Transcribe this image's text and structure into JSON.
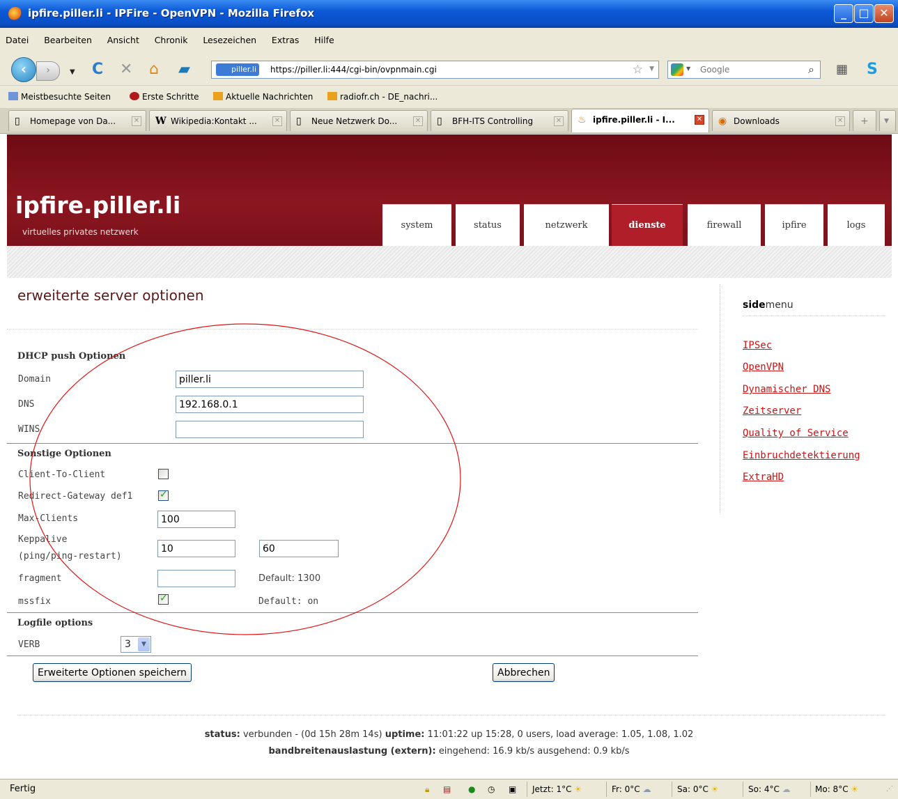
{
  "window": {
    "title": "ipfire.piller.li - IPFire - OpenVPN - Mozilla Firefox"
  },
  "menu": [
    "Datei",
    "Bearbeiten",
    "Ansicht",
    "Chronik",
    "Lesezeichen",
    "Extras",
    "Hilfe"
  ],
  "nav": {
    "site_badge": "piller.li",
    "url": "https://piller.li:444/cgi-bin/ovpnmain.cgi",
    "search_placeholder": "Google"
  },
  "bookmarks": [
    "Meistbesuchte Seiten",
    "Erste Schritte",
    "Aktuelle Nachrichten",
    "radiofr.ch - DE_nachri..."
  ],
  "tabs": [
    {
      "label": "Homepage von Da...",
      "icon": "page-icon"
    },
    {
      "label": "Wikipedia:Kontakt ...",
      "icon": "wikipedia-icon"
    },
    {
      "label": "Neue Netzwerk Do...",
      "icon": "page-icon"
    },
    {
      "label": "BFH-ITS Controlling",
      "icon": "page-icon"
    },
    {
      "label": "ipfire.piller.li - I...",
      "icon": "ipfire-icon",
      "active": true
    },
    {
      "label": "Downloads",
      "icon": "downloads-icon"
    }
  ],
  "site": {
    "brand": "ipfire.piller.li",
    "slogan": "virtuelles privates netzwerk",
    "nav": [
      "system",
      "status",
      "netzwerk",
      "dienste",
      "firewall",
      "ipfire",
      "logs"
    ],
    "active_nav": "dienste",
    "accent": "#b01e2a"
  },
  "page": {
    "title": "erweiterte server optionen",
    "dhcp": {
      "heading": "DHCP push Optionen",
      "domain_label": "Domain",
      "domain_value": "piller.li",
      "dns_label": "DNS",
      "dns_value": "192.168.0.1",
      "wins_label": "WINS",
      "wins_value": ""
    },
    "other": {
      "heading": "Sonstige Optionen",
      "c2c_label": "Client-To-Client",
      "c2c_checked": false,
      "redirect_label": "Redirect-Gateway def1",
      "redirect_checked": true,
      "maxclients_label": "Max-Clients",
      "maxclients_value": "100",
      "keepalive_label_1": "Keppalive",
      "keepalive_label_2": "(ping/ping-restart)",
      "keepalive_ping": "10",
      "keepalive_restart": "60",
      "fragment_label": "fragment",
      "fragment_value": "",
      "fragment_default": "Default: 1300",
      "mssfix_label": "mssfix",
      "mssfix_checked": true,
      "mssfix_default": "Default: on"
    },
    "log": {
      "heading": "Logfile options",
      "verb_label": "VERB",
      "verb_value": "3"
    },
    "save_button": "Erweiterte Optionen speichern",
    "cancel_button": "Abbrechen"
  },
  "sidemenu": {
    "title_bold": "side",
    "title_rest": "menu",
    "items": [
      "IPSec",
      "OpenVPN",
      "Dynamischer DNS",
      "Zeitserver",
      "Quality of Service",
      "Einbruchdetektierung",
      "ExtraHD"
    ]
  },
  "footer": {
    "status_label": "status:",
    "status_text": "verbunden - (0d 15h 28m 14s)",
    "uptime_label": "uptime:",
    "uptime_text": "11:01:22 up 15:28, 0 users, load average: 1.05, 1.08, 1.02",
    "bw_label": "bandbreitenauslastung (extern):",
    "bw_text": "eingehend: 16.9 kb/s ausgehend: 0.9 kb/s"
  },
  "statusbar": {
    "text": "Fertig",
    "weather": [
      "Jetzt: 1°C",
      "Fr: 0°C",
      "Sa: 0°C",
      "So: 4°C",
      "Mo: 8°C"
    ]
  }
}
